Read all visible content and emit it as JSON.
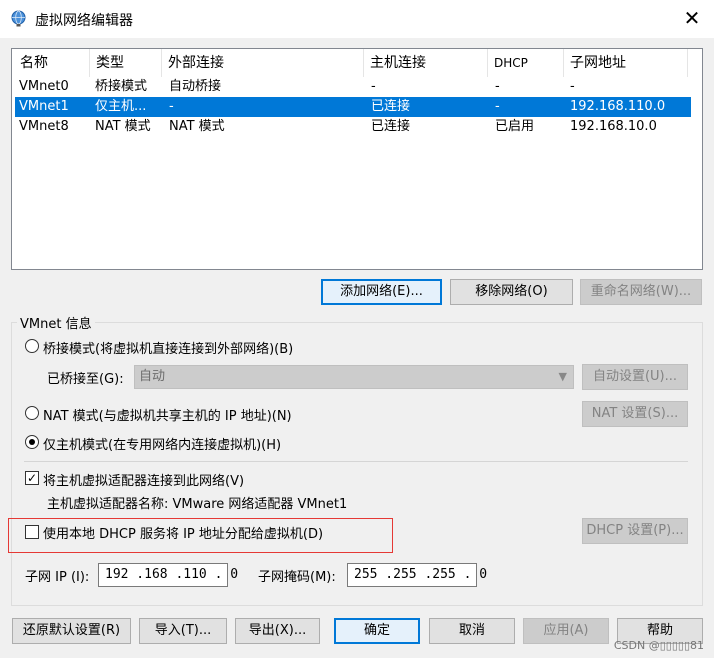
{
  "window": {
    "title": "虚拟网络编辑器",
    "close_glyph": "✕"
  },
  "network_list": {
    "columns": [
      "名称",
      "类型",
      "外部连接",
      "主机连接",
      "DHCP",
      "子网地址"
    ],
    "rows": [
      {
        "name": "VMnet0",
        "type": "桥接模式",
        "external": "自动桥接",
        "host": "-",
        "dhcp": "-",
        "subnet": "-",
        "selected": false
      },
      {
        "name": "VMnet1",
        "type": "仅主机...",
        "external": "-",
        "host": "已连接",
        "dhcp": "-",
        "subnet": "192.168.110.0",
        "selected": true
      },
      {
        "name": "VMnet8",
        "type": "NAT 模式",
        "external": "NAT 模式",
        "host": "已连接",
        "dhcp": "已启用",
        "subnet": "192.168.10.0",
        "selected": false
      }
    ]
  },
  "list_buttons": {
    "add": "添加网络(E)...",
    "remove": "移除网络(O)",
    "rename": "重命名网络(W)..."
  },
  "vmnet_info": {
    "group_title": "VMnet 信息",
    "bridge_label": "桥接模式(将虚拟机直接连接到外部网络)(B)",
    "bridged_to_label": "已桥接至(G):",
    "bridged_to_value": "自动",
    "auto_settings": "自动设置(U)...",
    "nat_label": "NAT 模式(与虚拟机共享主机的 IP 地址)(N)",
    "nat_settings": "NAT 设置(S)...",
    "hostonly_label": "仅主机模式(在专用网络内连接虚拟机)(H)",
    "connect_adapter_label": "将主机虚拟适配器连接到此网络(V)",
    "adapter_name_text": "主机虚拟适配器名称: VMware 网络适配器 VMnet1",
    "dhcp_label": "使用本地 DHCP 服务将 IP 地址分配给虚拟机(D)",
    "dhcp_settings": "DHCP 设置(P)...",
    "subnet_ip_label": "子网 IP (I):",
    "subnet_ip_value": "192 .168 .110 . 0",
    "subnet_mask_label": "子网掩码(M):",
    "subnet_mask_value": "255 .255 .255 . 0"
  },
  "bottom_buttons": {
    "restore": "还原默认设置(R)",
    "import": "导入(T)...",
    "export": "导出(X)...",
    "ok": "确定",
    "cancel": "取消",
    "apply": "应用(A)",
    "help": "帮助"
  },
  "watermark": "CSDN @▯▯▯▯▯81",
  "colors": {
    "selection": "#0078d7",
    "highlight_box": "#e53935"
  }
}
